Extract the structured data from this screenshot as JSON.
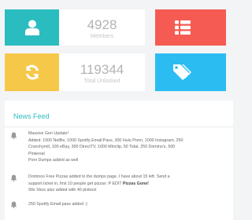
{
  "stats": [
    {
      "value": "4928",
      "label": "Members",
      "color": "#2bbcc0",
      "icon": "user-icon"
    },
    {
      "value": "",
      "label": "",
      "color": "#f55b52",
      "icon": "list-icon"
    },
    {
      "value": "119344",
      "label": "Total Unlocked",
      "color": "#f6c84a",
      "icon": "refresh-icon"
    },
    {
      "value": "",
      "label": "",
      "color": "#2bbcf2",
      "icon": "tag-icon"
    }
  ],
  "feed": {
    "title": "News Feed",
    "items": [
      {
        "icon": "bell-icon",
        "lines": [
          "Massive Gen Update!",
          "Added: 1000 Netflix, 1000 Spotify Email:Pass, 300 Hulu Prem, 1000 Instagram, 250",
          "Crunchyroll, 100 eBay, 300 DirectTV, 1000 Minclip, 50 Tidal, 250 Domino's, 500",
          "Pinterest",
          "Porn Dumps added as well"
        ]
      },
      {
        "icon": "bell-icon",
        "line1": "Dominos Free Pizzas added to the dumps page. I have about 15 left. Send a",
        "line2_pre": "support ticket in, first 10 people get pizzas :P EDIT",
        "line2_bold": "Pizzas Gone!",
        "line3": "90s Xbox also added with 40 pinboxt"
      },
      {
        "icon": "bell-icon",
        "line1": "250 Spotify Email:pass added :)"
      }
    ]
  }
}
